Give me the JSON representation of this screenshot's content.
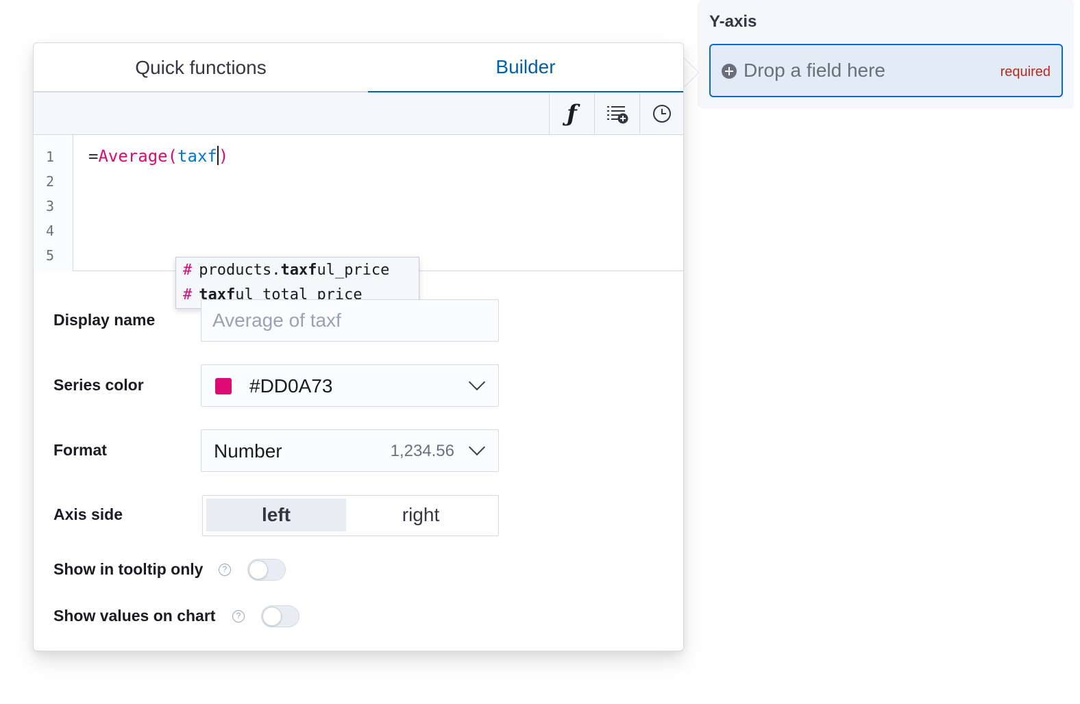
{
  "y_axis": {
    "title": "Y-axis",
    "drop_label": "Drop a field here",
    "required_label": "required"
  },
  "tabs": [
    {
      "label": "Quick functions",
      "active": false
    },
    {
      "label": "Builder",
      "active": true
    }
  ],
  "toolbar": {
    "icons": [
      "function-icon",
      "list-add-icon",
      "clock-icon"
    ]
  },
  "editor": {
    "line_numbers": [
      "1",
      "2",
      "3",
      "4",
      "5"
    ],
    "code": {
      "eq": "=",
      "function": "Average(",
      "argument": "taxf",
      "close": ")"
    },
    "suggestions": [
      {
        "prefix": "products.",
        "match": "taxf",
        "suffix": "ul_price"
      },
      {
        "prefix": "",
        "match": "taxf",
        "suffix": "ul_total_price"
      }
    ],
    "suggestion_symbol": "#"
  },
  "form": {
    "display_name": {
      "label": "Display name",
      "placeholder": "Average of taxf"
    },
    "series_color": {
      "label": "Series color",
      "value": "#DD0A73",
      "color": "#dd0a73"
    },
    "format": {
      "label": "Format",
      "value": "Number",
      "example": "1,234.56"
    },
    "axis_side": {
      "label": "Axis side",
      "options": [
        "left",
        "right"
      ],
      "selected": "left"
    },
    "tooltip_only": {
      "label": "Show in tooltip only",
      "enabled": false
    },
    "values_on_chart": {
      "label": "Show values on chart",
      "enabled": false
    },
    "help_glyph": "?"
  },
  "colors": {
    "accent": "#0061a6",
    "drop_border": "#0b64dd",
    "required": "#bd271e"
  }
}
